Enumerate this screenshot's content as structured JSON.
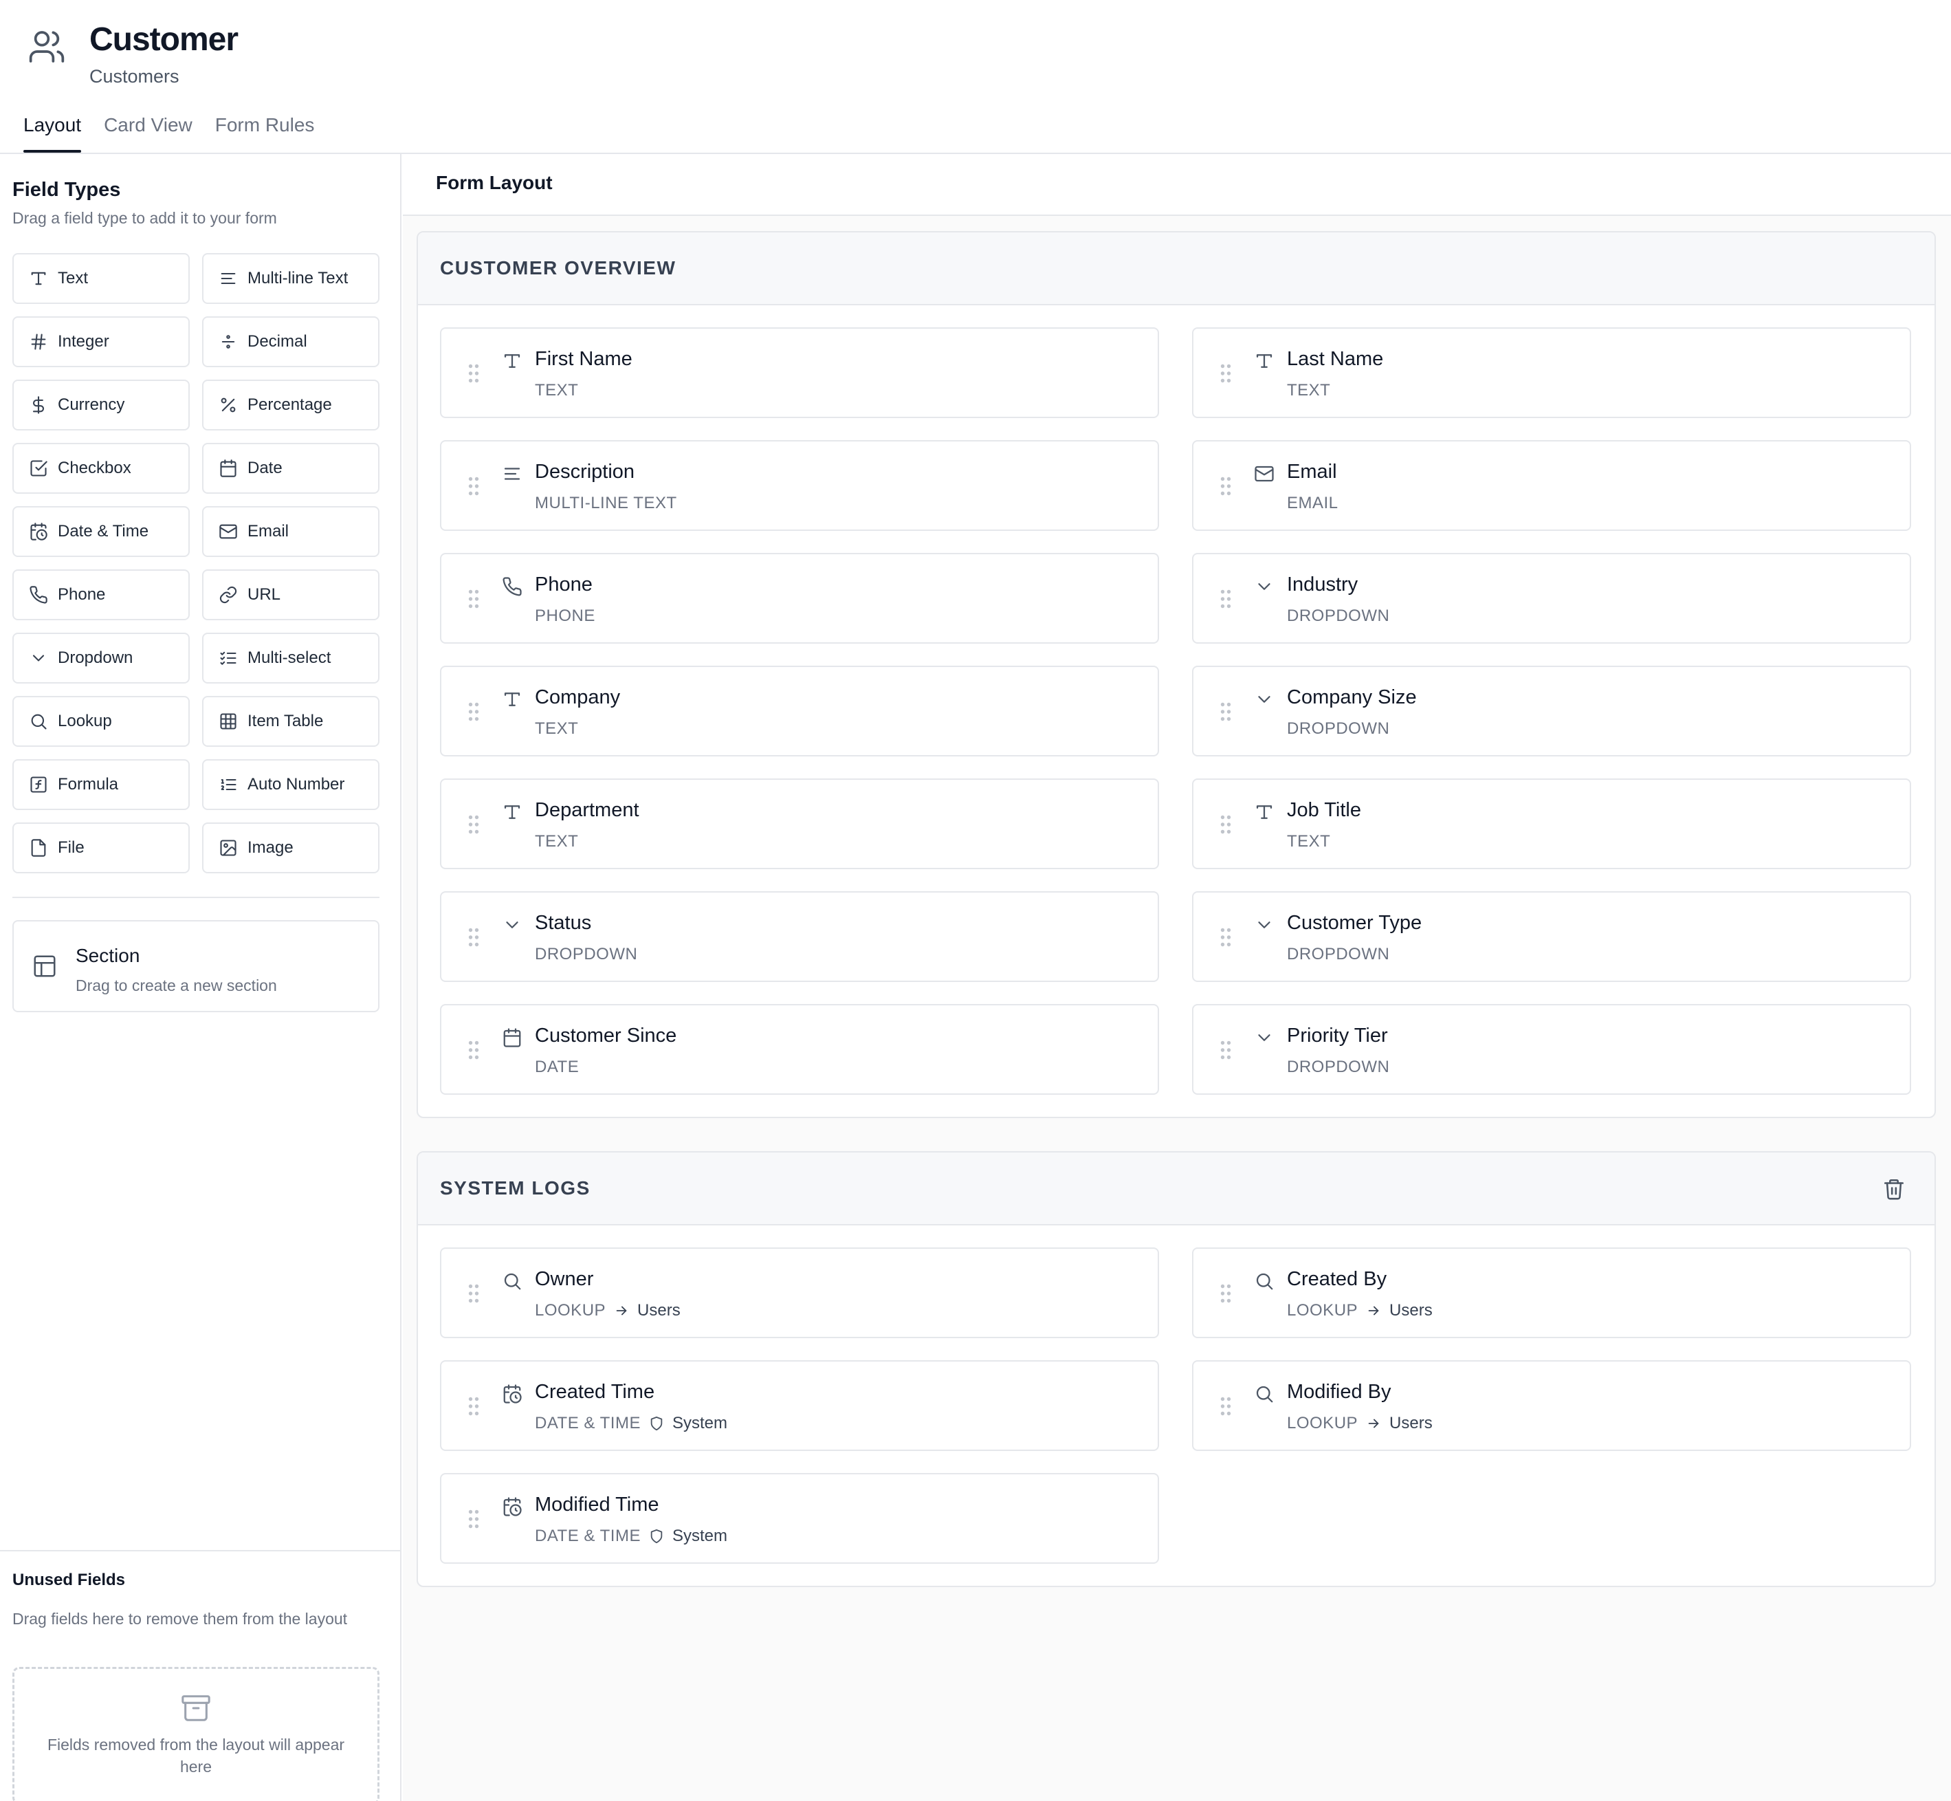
{
  "header": {
    "title": "Customer",
    "subtitle": "Customers",
    "icon": "users-icon"
  },
  "tabs": [
    {
      "label": "Layout",
      "active": true
    },
    {
      "label": "Card View"
    },
    {
      "label": "Form Rules"
    }
  ],
  "sidebar": {
    "title": "Field Types",
    "subtitle": "Drag a field type to add it to your form",
    "field_types": [
      {
        "label": "Text",
        "icon": "text-icon"
      },
      {
        "label": "Multi-line Text",
        "icon": "align-left-icon"
      },
      {
        "label": "Integer",
        "icon": "hash-icon"
      },
      {
        "label": "Decimal",
        "icon": "divide-icon"
      },
      {
        "label": "Currency",
        "icon": "dollar-icon"
      },
      {
        "label": "Percentage",
        "icon": "percent-icon"
      },
      {
        "label": "Checkbox",
        "icon": "checkbox-icon"
      },
      {
        "label": "Date",
        "icon": "calendar-icon"
      },
      {
        "label": "Date & Time",
        "icon": "calendar-clock-icon"
      },
      {
        "label": "Email",
        "icon": "mail-icon"
      },
      {
        "label": "Phone",
        "icon": "phone-icon"
      },
      {
        "label": "URL",
        "icon": "link-icon"
      },
      {
        "label": "Dropdown",
        "icon": "chevron-down-icon"
      },
      {
        "label": "Multi-select",
        "icon": "list-checks-icon"
      },
      {
        "label": "Lookup",
        "icon": "search-icon"
      },
      {
        "label": "Item Table",
        "icon": "table-icon"
      },
      {
        "label": "Formula",
        "icon": "function-icon"
      },
      {
        "label": "Auto Number",
        "icon": "list-ordered-icon"
      },
      {
        "label": "File",
        "icon": "file-icon"
      },
      {
        "label": "Image",
        "icon": "image-icon"
      }
    ],
    "section": {
      "title": "Section",
      "subtitle": "Drag to create a new section",
      "icon": "layout-icon"
    },
    "unused": {
      "title": "Unused Fields",
      "subtitle": "Drag fields here to remove them from the layout",
      "empty_text": "Fields removed from the layout will appear here",
      "icon": "archive-icon"
    }
  },
  "main": {
    "title": "Form Layout",
    "sections": [
      {
        "title": "CUSTOMER OVERVIEW",
        "deletable": false,
        "fields": [
          {
            "name": "First Name",
            "type": "TEXT",
            "icon": "text-icon"
          },
          {
            "name": "Last Name",
            "type": "TEXT",
            "icon": "text-icon"
          },
          {
            "name": "Description",
            "type": "MULTI-LINE TEXT",
            "icon": "align-left-icon"
          },
          {
            "name": "Email",
            "type": "EMAIL",
            "icon": "mail-icon"
          },
          {
            "name": "Phone",
            "type": "PHONE",
            "icon": "phone-icon"
          },
          {
            "name": "Industry",
            "type": "DROPDOWN",
            "icon": "chevron-down-icon"
          },
          {
            "name": "Company",
            "type": "TEXT",
            "icon": "text-icon"
          },
          {
            "name": "Company Size",
            "type": "DROPDOWN",
            "icon": "chevron-down-icon"
          },
          {
            "name": "Department",
            "type": "TEXT",
            "icon": "text-icon"
          },
          {
            "name": "Job Title",
            "type": "TEXT",
            "icon": "text-icon"
          },
          {
            "name": "Status",
            "type": "DROPDOWN",
            "icon": "chevron-down-icon"
          },
          {
            "name": "Customer Type",
            "type": "DROPDOWN",
            "icon": "chevron-down-icon"
          },
          {
            "name": "Customer Since",
            "type": "DATE",
            "icon": "calendar-icon"
          },
          {
            "name": "Priority Tier",
            "type": "DROPDOWN",
            "icon": "chevron-down-icon"
          }
        ]
      },
      {
        "title": "SYSTEM LOGS",
        "deletable": true,
        "delete_icon": "trash-icon",
        "fields": [
          {
            "name": "Owner",
            "type": "LOOKUP",
            "icon": "search-icon",
            "target": "Users"
          },
          {
            "name": "Created By",
            "type": "LOOKUP",
            "icon": "search-icon",
            "target": "Users"
          },
          {
            "name": "Created Time",
            "type": "DATE & TIME",
            "icon": "calendar-clock-icon",
            "system": "System"
          },
          {
            "name": "Modified By",
            "type": "LOOKUP",
            "icon": "search-icon",
            "target": "Users"
          },
          {
            "name": "Modified Time",
            "type": "DATE & TIME",
            "icon": "calendar-clock-icon",
            "system": "System"
          }
        ]
      }
    ]
  }
}
